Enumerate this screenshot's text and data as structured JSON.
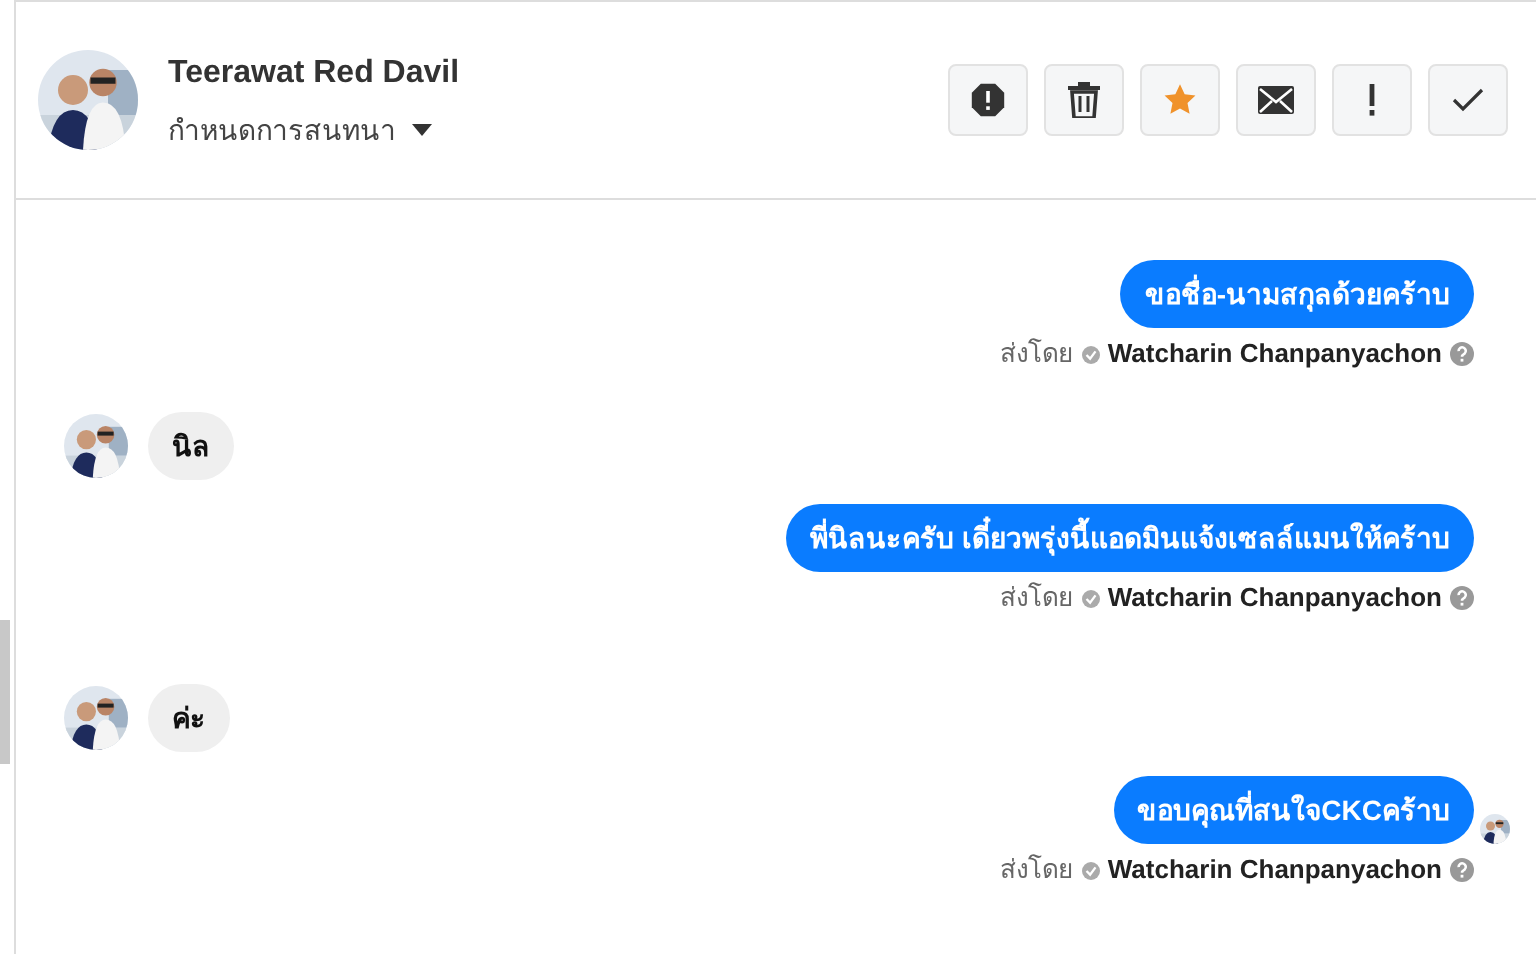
{
  "header": {
    "name": "Teerawat Red Davil",
    "assign_label": "กำหนดการสนทนา",
    "actions": [
      {
        "kind": "spam",
        "active": false
      },
      {
        "kind": "trash",
        "active": false
      },
      {
        "kind": "star",
        "active": true
      },
      {
        "kind": "mail",
        "active": false
      },
      {
        "kind": "important",
        "active": false
      },
      {
        "kind": "done",
        "active": false
      }
    ]
  },
  "messages": [
    {
      "kind": "outgoing",
      "text": "ขอชื่อ-นามสกุลด้วยคร้าบ",
      "sent_by_label": "ส่งโดย",
      "sender": "Watcharin Chanpanyachon",
      "seen": false
    },
    {
      "kind": "incoming",
      "text": "นิล"
    },
    {
      "kind": "outgoing",
      "text": "พี่นิลนะครับ เดี๋ยวพรุ่งนี้แอดมินแจ้งเซลล์แมนให้คร้าบ",
      "sent_by_label": "ส่งโดย",
      "sender": "Watcharin Chanpanyachon",
      "seen": false
    },
    {
      "kind": "incoming",
      "text": "ค่ะ"
    },
    {
      "kind": "outgoing",
      "text": "ขอบคุณที่สนใจCKCคร้าบ",
      "sent_by_label": "ส่งโดย",
      "sender": "Watcharin Chanpanyachon",
      "seen": true
    }
  ]
}
